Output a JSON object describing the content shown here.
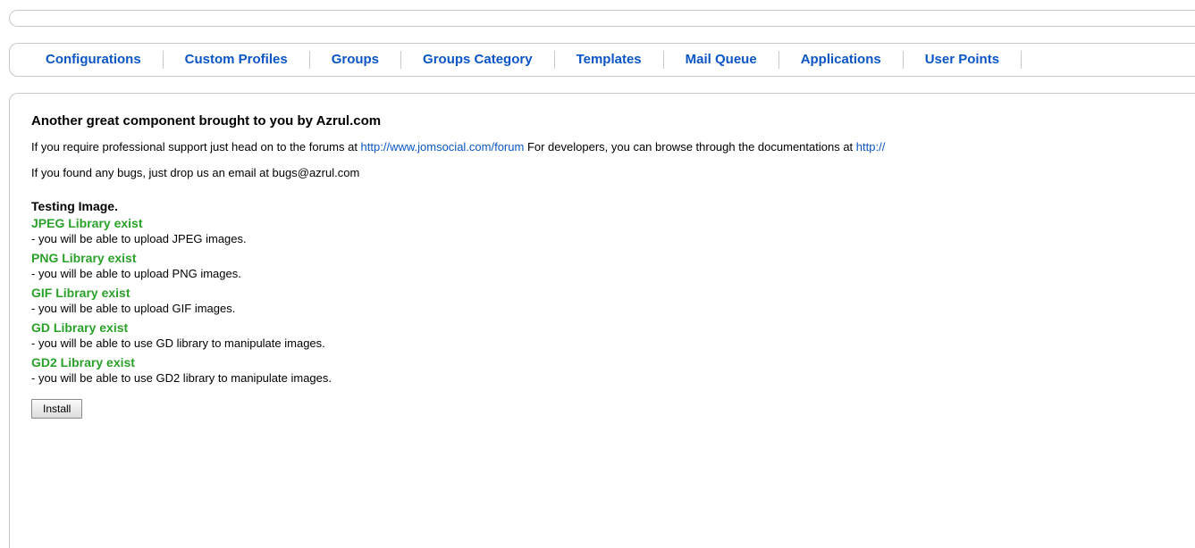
{
  "nav": {
    "items": [
      {
        "label": "Configurations"
      },
      {
        "label": "Custom Profiles"
      },
      {
        "label": "Groups"
      },
      {
        "label": "Groups Category"
      },
      {
        "label": "Templates"
      },
      {
        "label": "Mail Queue"
      },
      {
        "label": "Applications"
      },
      {
        "label": "User Points"
      }
    ]
  },
  "intro": {
    "heading": "Another great component brought to you by Azrul.com",
    "support_prefix": "If you require professional support just head on to the forums at ",
    "forum_link": "http://www.jomsocial.com/forum",
    "support_middle": " For developers, you can browse through the documentations at ",
    "docs_link": "http://",
    "bugs_text": "If you found any bugs, just drop us an email at bugs@azrul.com"
  },
  "testing": {
    "title": "Testing Image.",
    "libraries": [
      {
        "name": "JPEG Library exist",
        "desc": "- you will be able to upload JPEG images."
      },
      {
        "name": "PNG Library exist",
        "desc": "- you will be able to upload PNG images."
      },
      {
        "name": "GIF Library exist",
        "desc": "- you will be able to upload GIF images."
      },
      {
        "name": "GD Library exist",
        "desc": "- you will be able to use GD library to manipulate images."
      },
      {
        "name": "GD2 Library exist",
        "desc": "- you will be able to use GD2 library to manipulate images."
      }
    ]
  },
  "install_label": "Install",
  "colors": {
    "link": "#0b55c4",
    "success": "#2aa12a",
    "border": "#c7c7c7"
  }
}
